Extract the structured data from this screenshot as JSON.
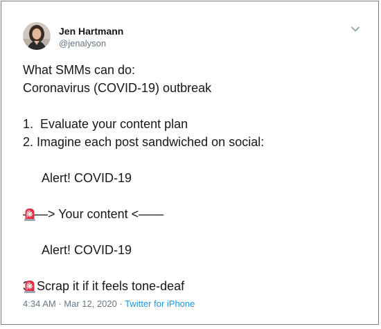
{
  "author": {
    "name": "Jen Hartmann",
    "handle": "@jenalyson"
  },
  "tweet": {
    "line1": "What SMMs can do:",
    "line2": "Coronavirus (COVID-19) outbreak",
    "line3": "",
    "line4": "1.  Evaluate your content plan",
    "line5": "2. Imagine each post sandwiched on social:",
    "line6": "",
    "line7": "Alert! COVID-19",
    "line8": "",
    "line9": "——> Your content <——",
    "line10": "",
    "line11": "Alert! COVID-19",
    "line12": "",
    "line13": "3. Scrap it if it feels tone-deaf"
  },
  "meta": {
    "time": "4:34 AM",
    "separator": " · ",
    "date": "Mar 12, 2020",
    "source": "Twitter for iPhone"
  },
  "icons": {
    "menu": "chevron-down-icon",
    "emoji": "rotating-light-emoji"
  },
  "colors": {
    "text": "#14171a",
    "secondary": "#657786",
    "link": "#1b95e0",
    "border": "#7a7a7a"
  }
}
